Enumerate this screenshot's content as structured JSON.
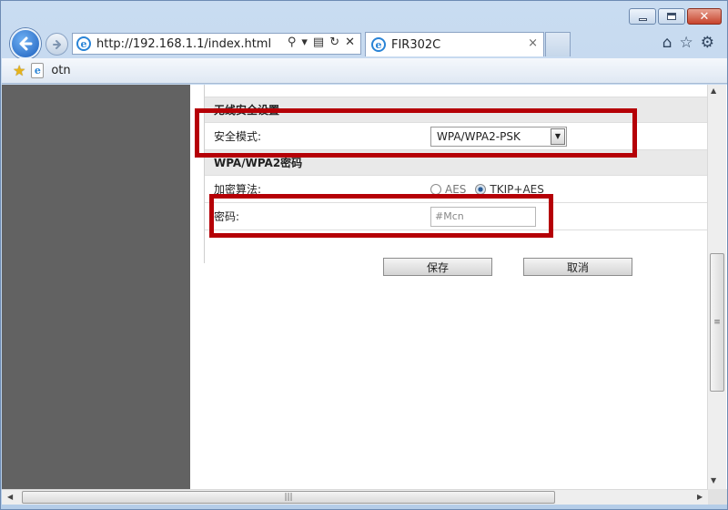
{
  "browser": {
    "address": "http://192.168.1.1/index.html",
    "tab_title": "FIR302C",
    "tab_close": "×",
    "favorites_label": "otn"
  },
  "caption": {
    "minimize": "–",
    "maximize": "□",
    "close": "✕"
  },
  "form": {
    "section_wireless_security": "无线安全设置",
    "security_mode_label": "安全模式:",
    "security_mode_value": "WPA/WPA2-PSK",
    "section_password": "WPA/WPA2密码",
    "encryption_label": "加密算法:",
    "encryption_options": [
      "AES",
      "TKIP+AES"
    ],
    "encryption_selected": "TKIP+AES",
    "password_label": "密码:",
    "password_value": "#Mcn"
  },
  "buttons": {
    "save": "保存",
    "cancel": "取消"
  },
  "colors": {
    "highlight": "#b50006",
    "left_pane": "#626262"
  }
}
